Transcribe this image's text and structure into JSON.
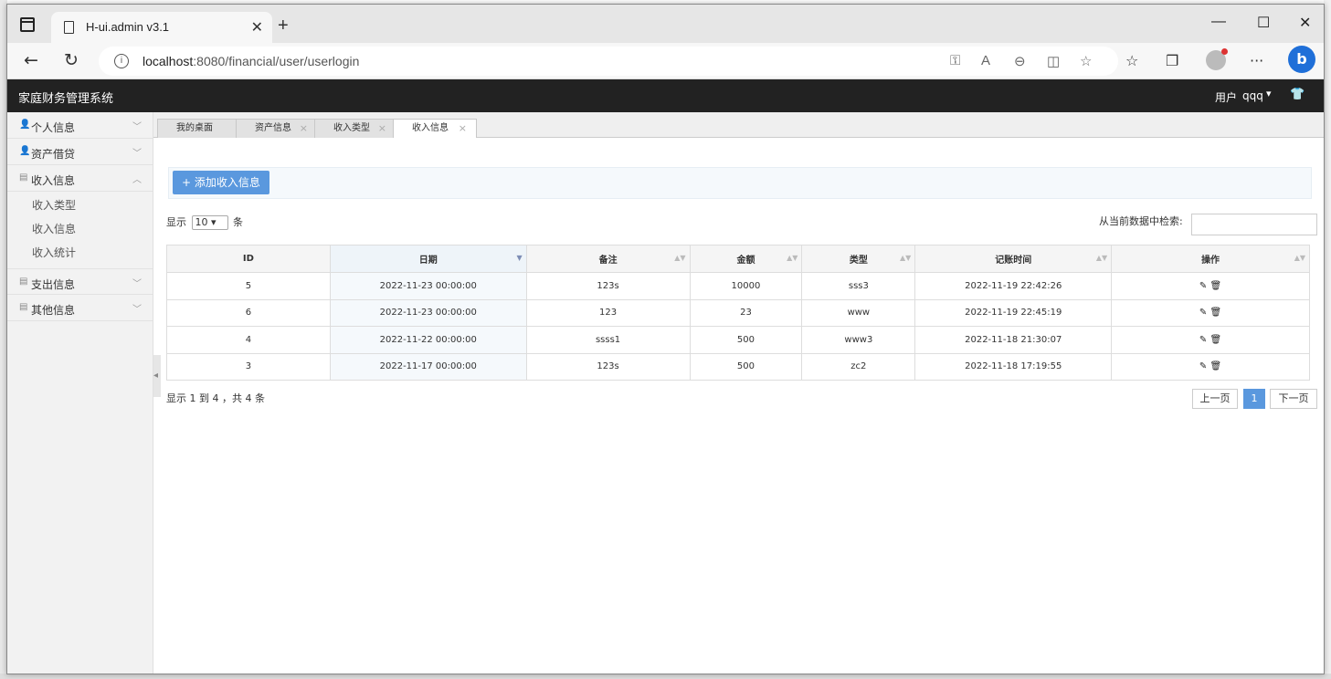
{
  "browser": {
    "tab_title": "H-ui.admin v3.1",
    "url_host": "localhost",
    "url_path": ":8080/financial/user/userlogin"
  },
  "app": {
    "title": "家庭财务管理系统",
    "user_label": "用户",
    "user_name": "qqq"
  },
  "sidebar": {
    "groups": [
      {
        "label": "个人信息",
        "expanded": false
      },
      {
        "label": "资产借贷",
        "expanded": false
      },
      {
        "label": "收入信息",
        "expanded": true,
        "items": [
          "收入类型",
          "收入信息",
          "收入统计"
        ]
      },
      {
        "label": "支出信息",
        "expanded": false
      },
      {
        "label": "其他信息",
        "expanded": false
      }
    ]
  },
  "content_tabs": [
    "我的桌面",
    "资产信息",
    "收入类型",
    "收入信息"
  ],
  "content_tabs_close": "×",
  "toolbar": {
    "add_label": "添加收入信息"
  },
  "list": {
    "show_prefix": "显示",
    "page_size": "10",
    "show_suffix": "条",
    "search_label": "从当前数据中检索:",
    "columns": [
      "ID",
      "日期",
      "备注",
      "金额",
      "类型",
      "记账时间",
      "操作"
    ],
    "rows": [
      [
        "5",
        "2022-11-23 00:00:00",
        "123s",
        "10000",
        "sss3",
        "2022-11-19 22:42:26"
      ],
      [
        "6",
        "2022-11-23 00:00:00",
        "123",
        "23",
        "www",
        "2022-11-19 22:45:19"
      ],
      [
        "4",
        "2022-11-22 00:00:00",
        "ssss1",
        "500",
        "www3",
        "2022-11-18 21:30:07"
      ],
      [
        "3",
        "2022-11-17 00:00:00",
        "123s",
        "500",
        "zc2",
        "2022-11-18 17:19:55"
      ]
    ],
    "info": "显示 1 到 4 ，共 4 条",
    "pager": {
      "prev": "上一页",
      "current": "1",
      "next": "下一页"
    }
  }
}
